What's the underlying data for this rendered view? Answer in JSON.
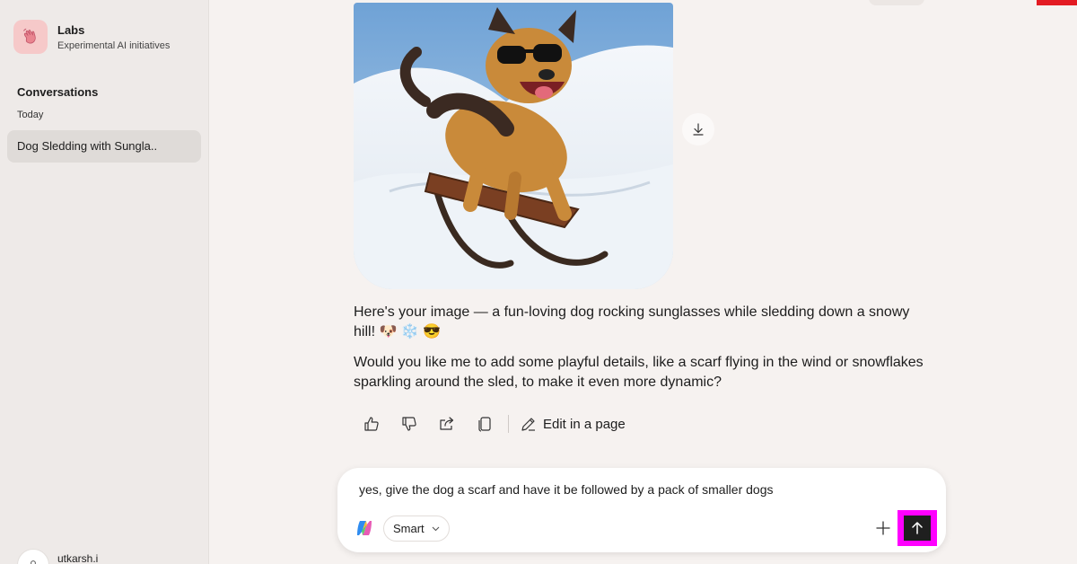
{
  "sidebar": {
    "brand_title": "Labs",
    "brand_subtitle": "Experimental AI initiatives",
    "brand_icon": "waving-hand-icon",
    "section_title": "Conversations",
    "date_group": "Today",
    "conversations": [
      {
        "title": "Dog Sledding with Sungla..",
        "active": true
      }
    ],
    "user_name": "utkarsh.i"
  },
  "main": {
    "image_alt": "Dog in sunglasses riding a sled down a snowy hill",
    "message_paragraphs": [
      "Here's your image — a fun-loving dog rocking sunglasses while sledding down a snowy hill! 🐶 ❄️ 😎",
      "Would you like me to add some playful details, like a scarf flying in the wind or snowflakes sparkling around the sled, to make it even more dynamic?"
    ],
    "actions": {
      "icons": [
        "thumbs-up-icon",
        "thumbs-down-icon",
        "share-icon",
        "copy-icon"
      ],
      "edit_label": "Edit in a page"
    }
  },
  "composer": {
    "input_value": "yes, give the dog a scarf and have it be followed by a pack of smaller dogs",
    "mode_label": "Smart",
    "send_highlight_color": "#ff00ff"
  },
  "colors": {
    "page_bg": "#f6f2f0",
    "sidebar_bg": "#eeeae8",
    "active_item_bg": "#dfdbd8",
    "accent_red": "#e31b23"
  }
}
